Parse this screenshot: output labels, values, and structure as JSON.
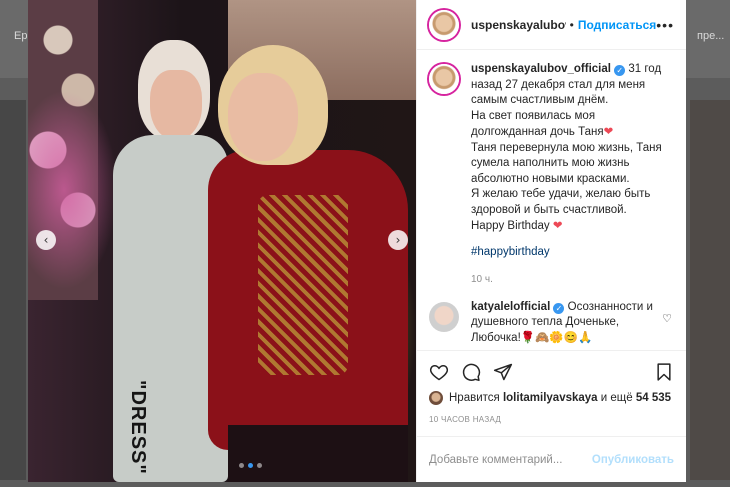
{
  "background": {
    "left_label": "Ер",
    "right_label": "пре..."
  },
  "post": {
    "author": "uspenskayalubov_official",
    "author_truncated": "uspenskayalubov_o",
    "separator": "•",
    "follow_label": "Подписаться",
    "more_label": "•••",
    "caption_lines": [
      "31 год назад 27 декабря стал для меня самым счастливым днём.",
      "На свет появилась моя долгожданная дочь Таня",
      "Таня перевернула мою жизнь, Таня сумела наполнить мою жизнь абсолютно новыми красками.",
      "Я желаю тебе удачи, желаю быть здоровой и быть счастливой.",
      "Happy Birthday"
    ],
    "hashtag": "#happybirthday",
    "caption_time": "10 ч.",
    "photo_text": "\"DRESS\"",
    "carousel_count": 3,
    "carousel_active": 1
  },
  "comments": [
    {
      "user": "katyalelofficial",
      "text": "Осознанности и душевного тепла Доченьке, Любочка!🌹🙈🌼😊🙏"
    }
  ],
  "likes": {
    "prefix": "Нравится",
    "user": "lolitamilyavskaya",
    "middle": "и ещё",
    "count": "54 535"
  },
  "post_time": "10 часов назад",
  "comment_input": {
    "placeholder": "Добавьте комментарий...",
    "submit_label": "Опубликовать"
  },
  "colors": {
    "link": "#0095f6",
    "hashtag": "#00376b",
    "heart": "#ed4956",
    "verified": "#3897f0"
  }
}
